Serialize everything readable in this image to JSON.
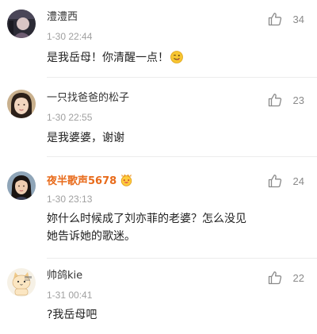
{
  "comments": [
    {
      "username": "澧澧西",
      "time": "1-30 22:44",
      "text": "是我岳母！你清醒一点！",
      "likes": "34",
      "liked": false
    },
    {
      "username": "一只找爸爸的松子",
      "time": "1-30 22:55",
      "text": "是我婆婆，谢谢",
      "likes": "23",
      "liked": false
    },
    {
      "username": "夜半歌声5678",
      "time": "1-30 23:13",
      "text_line1": "妳什么时候成了刘亦菲的老婆？怎么没见",
      "text_line2": "她告诉她的歌迷。",
      "likes": "24",
      "liked": false,
      "name_color": "#e86b1b"
    },
    {
      "username": "帅鸽kie",
      "time": "1-31 00:41",
      "text": "?我岳母吧",
      "likes": "22",
      "liked": false
    }
  ],
  "icons": {
    "like": "thumbs-up-outline-icon",
    "emoji": "winking-tongue-face-icon",
    "badge": "vip-smiley-badge-icon"
  },
  "colors": {
    "background": "#ffffff",
    "username": "#333333",
    "vip_username": "#e86b1b",
    "timestamp": "#a0a0a0",
    "like_count": "#8a8a8a",
    "divider": "#ececec"
  }
}
